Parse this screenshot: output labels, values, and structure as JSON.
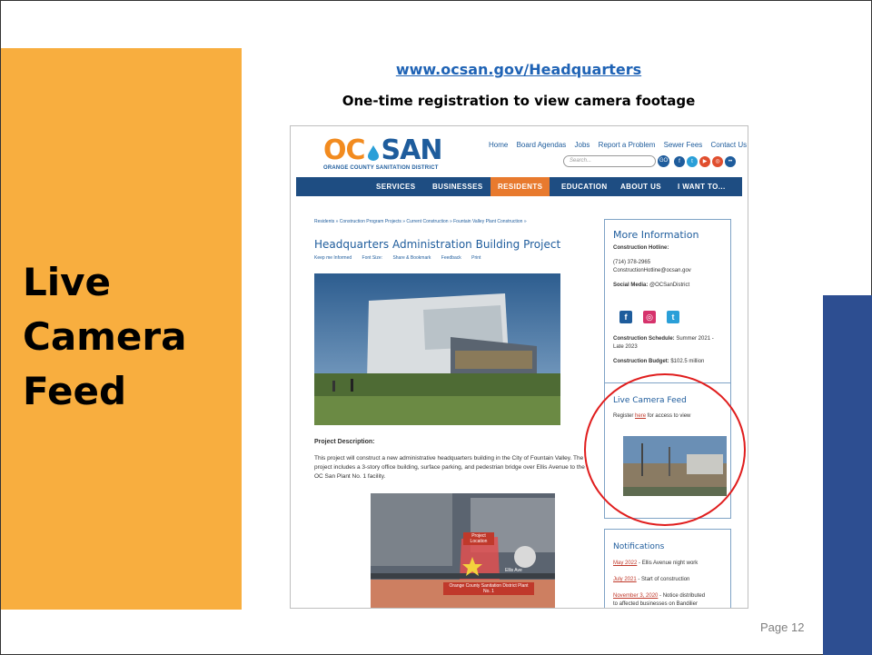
{
  "slide": {
    "big_title_lines": [
      "Live",
      "Camera",
      "Feed"
    ],
    "url": "www.ocsan.gov/Headquarters",
    "subtitle": "One-time registration to view camera footage",
    "page_number": "Page 12"
  },
  "colors": {
    "orange_panel": "#F8AE3F",
    "blue_bar": "#2D4E91",
    "highlight_circle": "#E01E1E",
    "nav_bg": "#1E4D82",
    "nav_active": "#E87A2E"
  },
  "site": {
    "logo_oc": "OC",
    "logo_san": "SAN",
    "logo_sub": "ORANGE COUNTY SANITATION DISTRICT",
    "top_links": [
      "Home",
      "Board Agendas",
      "Jobs",
      "Report a Problem",
      "Sewer Fees",
      "Contact Us"
    ],
    "search_placeholder": "Search...",
    "go_label": "GO",
    "social_icons": [
      "facebook-icon",
      "twitter-icon",
      "youtube-icon",
      "instagram-icon",
      "flickr-icon"
    ],
    "nav": [
      "SERVICES",
      "BUSINESSES",
      "RESIDENTS",
      "EDUCATION",
      "ABOUT US",
      "I WANT TO..."
    ],
    "nav_active": "RESIDENTS",
    "breadcrumbs": "Residents » Construction Program Projects » Current Construction » Fountain Valley Plant Construction »",
    "page_heading": "Headquarters Administration Building Project",
    "tools": [
      "Keep me Informed",
      "Font Size:",
      "Share & Bookmark",
      "Feedback",
      "Print"
    ],
    "project_desc_label": "Project Description:",
    "project_desc": "This project will construct a new administrative headquarters building in the City of Fountain Valley. The project includes a 3-story office building, surface parking, and pedestrian bridge over Ellis Avenue to the OC San Plant No. 1 facility.",
    "map_labels": {
      "project": "Project Location",
      "street": "Ellis Ave",
      "plant": "Orange County Sanitation District Plant No. 1"
    },
    "more_info": {
      "title": "More Information",
      "hotline_label": "Construction Hotline:",
      "phone": "(714) 378-2965",
      "email": "ConstructionHotline@ocsan.gov",
      "social_label": "Social Media:",
      "social_handle": "@OCSanDistrict",
      "schedule_label": "Construction Schedule:",
      "schedule_value": "Summer 2021 -",
      "schedule_value2": "Late 2023",
      "budget_label": "Construction Budget:",
      "budget_value": "$102.5 million"
    },
    "camera": {
      "title": "Live Camera Feed",
      "register_pre": "Register",
      "register_link": "here",
      "register_post": "for access to view"
    },
    "notifications": {
      "title": "Notifications",
      "items": [
        {
          "date": "May 2022",
          "text": "- Ellis Avenue night work"
        },
        {
          "date": "July 2021",
          "text": "- Start of construction"
        },
        {
          "date": "November 3, 2020",
          "text": "- Notice distributed"
        }
      ],
      "continued": "to affected businesses on Bandilier"
    }
  }
}
